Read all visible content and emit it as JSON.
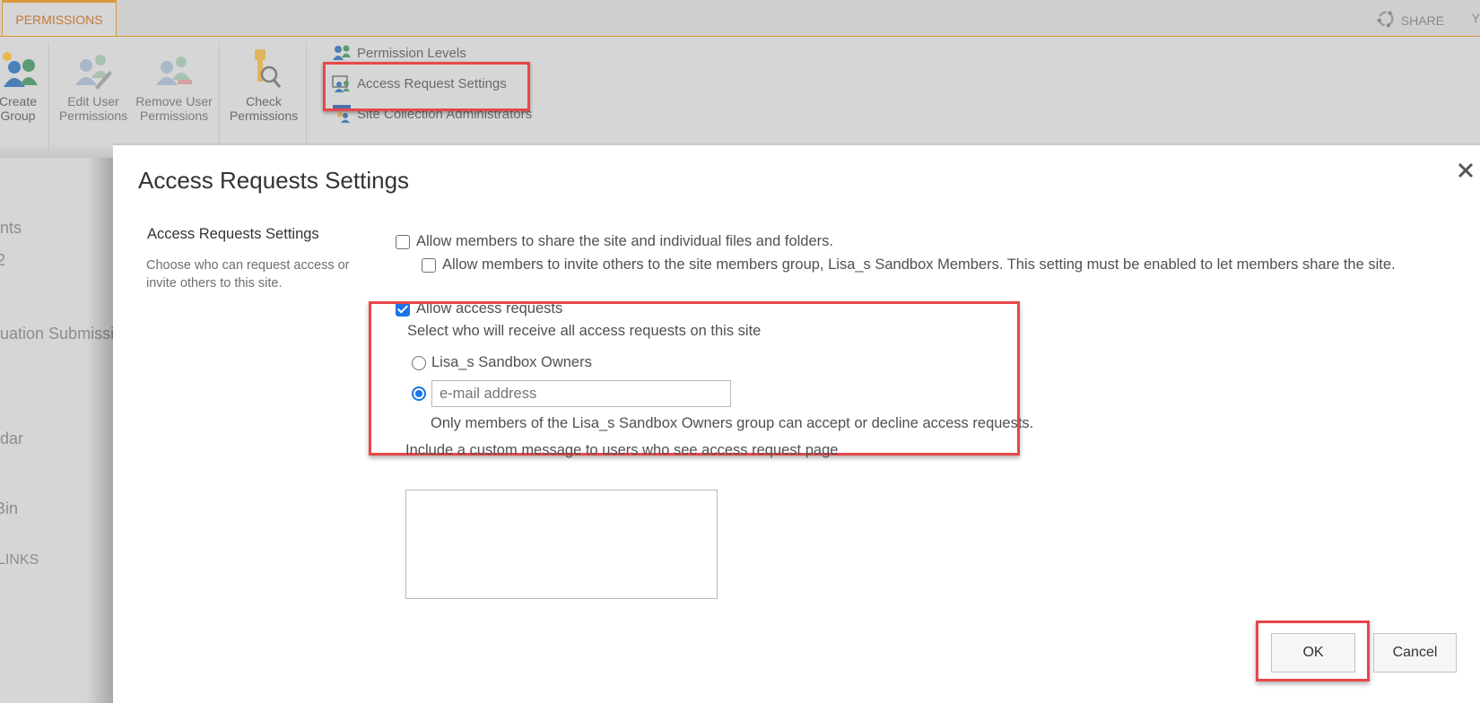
{
  "topbar": {
    "active_tab": "PERMISSIONS",
    "share_label": "SHARE",
    "follow_partial": "Y"
  },
  "ribbon": {
    "buttons": [
      {
        "label_line1": "Create",
        "label_line2": "Group",
        "icon": "create-group-icon"
      },
      {
        "label_line1": "Edit User",
        "label_line2": "Permissions",
        "icon": "edit-user-permissions-icon"
      },
      {
        "label_line1": "Remove User",
        "label_line2": "Permissions",
        "icon": "remove-user-permissions-icon"
      },
      {
        "label_line1": "Check",
        "label_line2": "Permissions",
        "icon": "check-permissions-icon"
      }
    ],
    "small_buttons": [
      {
        "label": "Permission Levels",
        "icon": "permission-levels-icon"
      },
      {
        "label": "Access Request Settings",
        "icon": "access-request-settings-icon"
      },
      {
        "label": "Site Collection Administrators",
        "icon": "site-collection-admins-icon"
      }
    ]
  },
  "leftnav": {
    "items": [
      "nts",
      "2",
      "uation Submissi",
      "dar",
      "Bin",
      "LINKS"
    ]
  },
  "dialog": {
    "title": "Access Requests Settings",
    "section_title": "Access Requests Settings",
    "section_description": "Choose who can request access or invite others to this site.",
    "options": {
      "share_site": {
        "label": "Allow members to share the site and individual files and folders.",
        "checked": false
      },
      "invite_others": {
        "label": "Allow members to invite others to the site members group, Lisa_s Sandbox Members. This setting must be enabled to let members share the site.",
        "checked": false
      },
      "allow_access_requests": {
        "label": "Allow access requests",
        "checked": true
      }
    },
    "recipient_prompt": "Select who will receive all access requests on this site",
    "recipients": {
      "owners_group": {
        "label": "Lisa_s Sandbox Owners",
        "selected": false
      },
      "email": {
        "selected": true,
        "placeholder": "e-mail address",
        "value": ""
      }
    },
    "owners_note": "Only members of the Lisa_s Sandbox Owners group can accept or decline access requests.",
    "custom_message_label": "Include a custom message to users who see access request page",
    "custom_message_value": "",
    "ok_label": "OK",
    "cancel_label": "Cancel"
  },
  "colors": {
    "accent_orange": "#d89a3c",
    "highlight_red": "#e8474a",
    "checkbox_blue": "#1a73e8"
  }
}
